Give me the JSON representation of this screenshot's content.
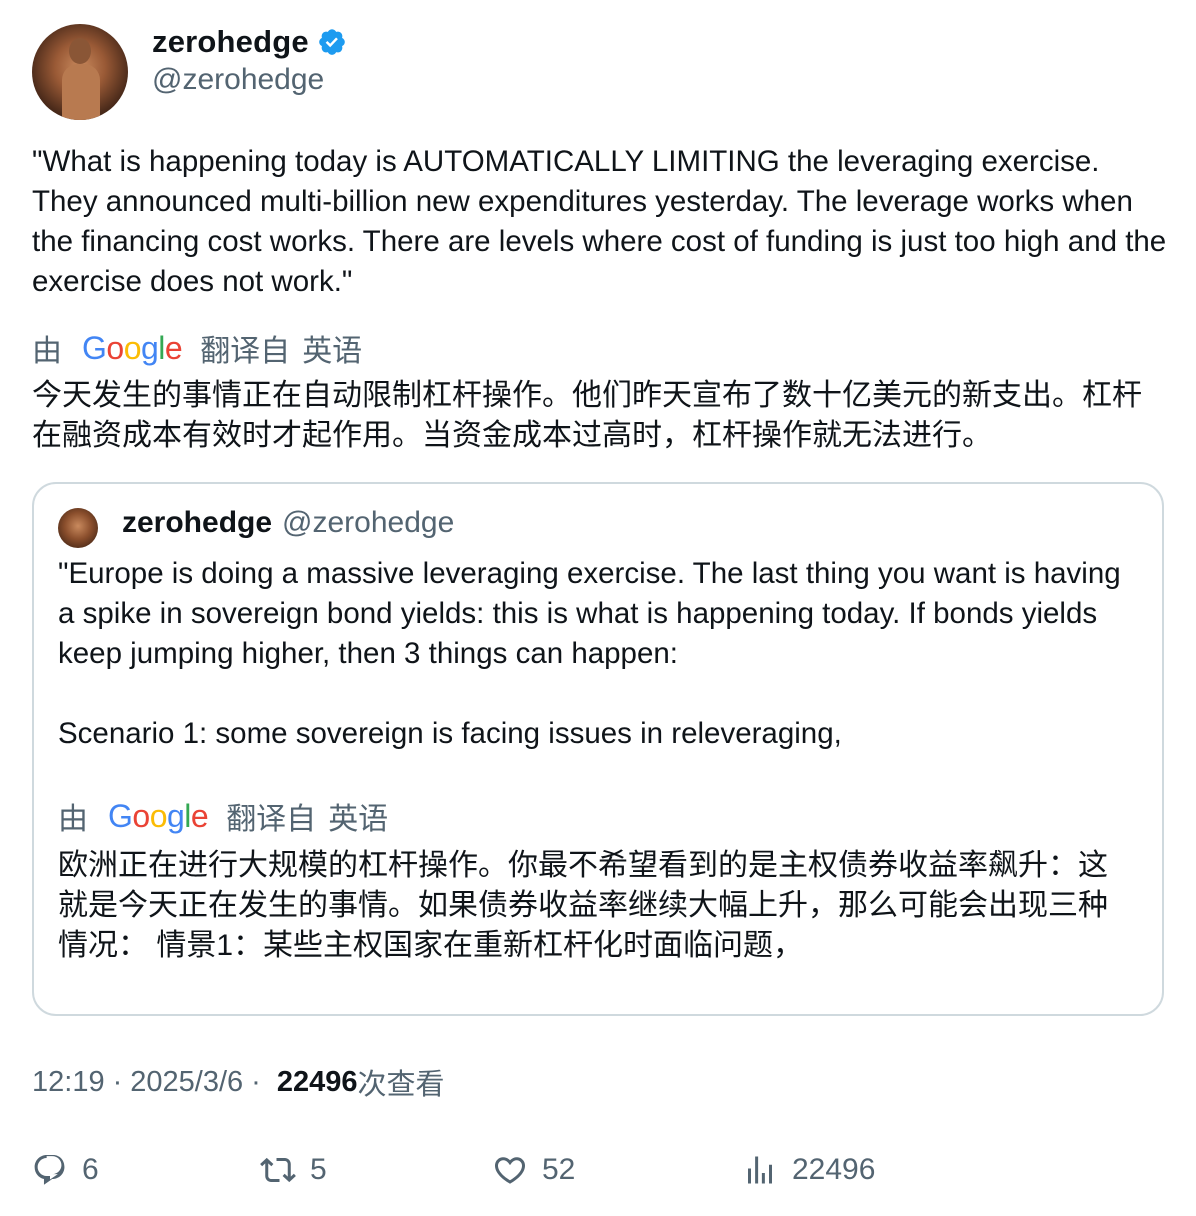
{
  "tweet": {
    "author_name": "zerohedge",
    "author_handle": "@zerohedge",
    "text": "\"What is happening today is AUTOMATICALLY LIMITING the leveraging exercise. They announced multi-billion new expenditures yesterday. The leverage works when the financing cost works. There are levels where cost of funding is just too high and the exercise does not work.\"",
    "translate_prefix": "由",
    "translate_brand": "Google",
    "translate_suffix": "翻译自",
    "translate_lang": "英语",
    "translation": "今天发生的事情正在自动限制杠杆操作。他们昨天宣布了数十亿美元的新支出。杠杆在融资成本有效时才起作用。当资金成本过高时，杠杆操作就无法进行。"
  },
  "quote": {
    "author_name": "zerohedge",
    "author_handle": "@zerohedge",
    "text": "\"Europe is doing a massive leveraging exercise. The last thing you want is having a spike in sovereign bond yields: this is what is happening today. If bonds yields keep jumping higher, then 3 things can happen:\n\nScenario 1: some sovereign is facing issues in releveraging,",
    "translate_prefix": "由",
    "translate_brand": "Google",
    "translate_suffix": "翻译自",
    "translate_lang": "英语",
    "translation": "欧洲正在进行大规模的杠杆操作。你最不希望看到的是主权债券收益率飙升：这就是今天正在发生的事情。如果债券收益率继续大幅上升，那么可能会出现三种情况： 情景1：某些主权国家在重新杠杆化时面临问题，"
  },
  "meta": {
    "time": "12:19",
    "separator": "·",
    "date": "2025/3/6",
    "views_count": "22496",
    "views_label": "次查看"
  },
  "actions": {
    "reply_count": "6",
    "retweet_count": "5",
    "like_count": "52",
    "views_count": "22496"
  },
  "icons": {
    "verified": "verified-badge-icon",
    "reply": "reply-icon",
    "retweet": "retweet-icon",
    "like": "heart-icon",
    "views": "analytics-icon"
  },
  "colors": {
    "text_primary": "#0f1419",
    "text_secondary": "#536471",
    "verified_blue": "#1d9bf0",
    "border": "#cfd9de"
  }
}
